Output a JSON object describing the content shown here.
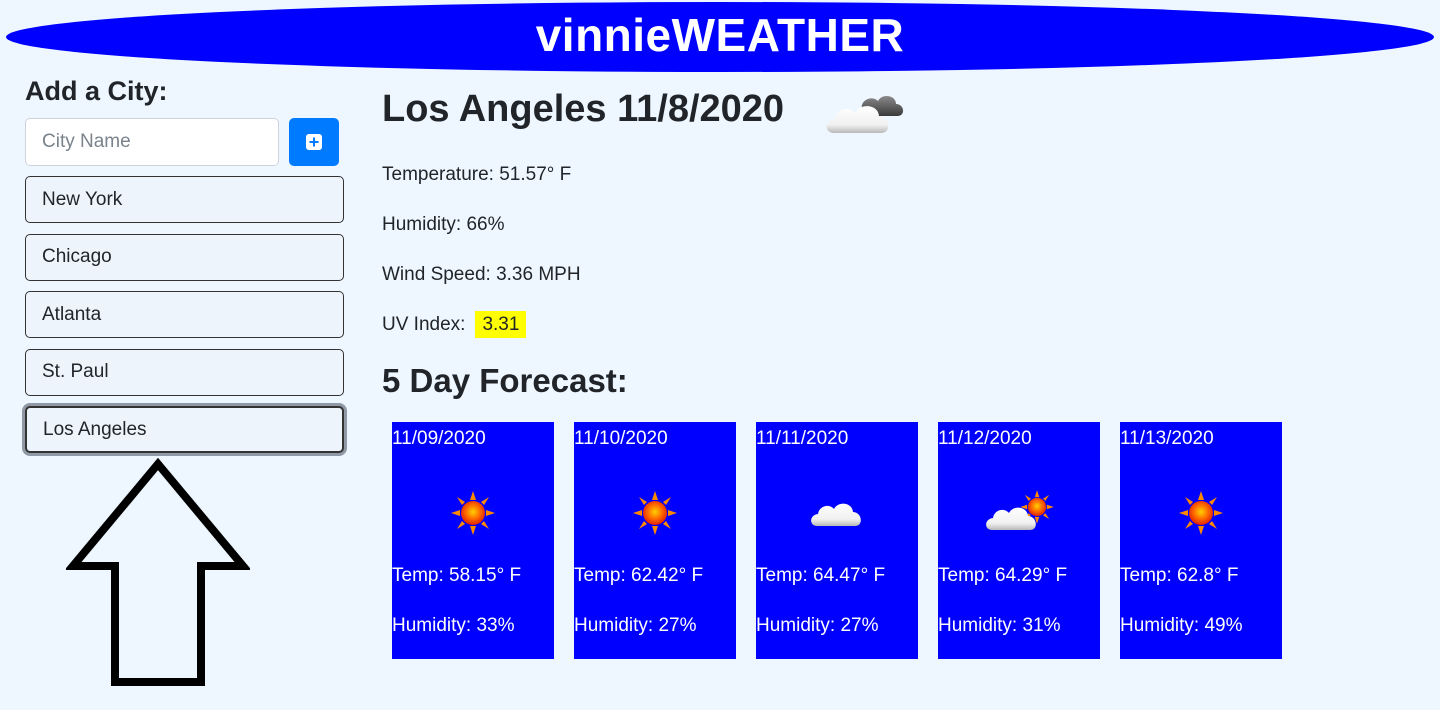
{
  "header": {
    "title": "vinnieWEATHER",
    "color": "#0000ff"
  },
  "sidebar": {
    "heading": "Add a City:",
    "search": {
      "placeholder": "City Name",
      "value": ""
    },
    "add_button_icon": "plus-square-icon",
    "cities": [
      {
        "label": "New York"
      },
      {
        "label": "Chicago"
      },
      {
        "label": "Atlanta"
      },
      {
        "label": "St. Paul"
      },
      {
        "label": "Los Angeles",
        "active": true
      }
    ]
  },
  "current": {
    "title": "Los Angeles 11/8/2020",
    "icon": "clouds-icon",
    "temperature": "Temperature: 51.57° F",
    "humidity": "Humidity: 66%",
    "wind": "Wind Speed: 3.36 MPH",
    "uv_label": "UV Index:",
    "uv_value": "3.31",
    "uv_color": "#ffff00"
  },
  "forecast": {
    "title": "5 Day Forecast:",
    "days": [
      {
        "date": "11/09/2020",
        "icon": "sun-icon",
        "temp": "Temp: 58.15° F",
        "humidity": "Humidity: 33%"
      },
      {
        "date": "11/10/2020",
        "icon": "sun-icon",
        "temp": "Temp: 62.42° F",
        "humidity": "Humidity: 27%"
      },
      {
        "date": "11/11/2020",
        "icon": "cloud-icon",
        "temp": "Temp: 64.47° F",
        "humidity": "Humidity: 27%"
      },
      {
        "date": "11/12/2020",
        "icon": "partly-cloudy-icon",
        "temp": "Temp: 64.29° F",
        "humidity": "Humidity: 31%"
      },
      {
        "date": "11/13/2020",
        "icon": "sun-icon",
        "temp": "Temp: 62.8° F",
        "humidity": "Humidity: 49%"
      }
    ]
  },
  "annotation": {
    "icon": "up-arrow-icon"
  }
}
